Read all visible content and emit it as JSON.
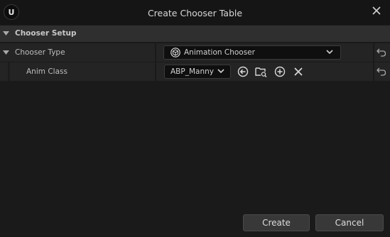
{
  "window": {
    "title": "Create Chooser Table",
    "logo_text": "U"
  },
  "section": {
    "label": "Chooser Setup"
  },
  "rows": [
    {
      "label": "Chooser Type",
      "value": "Animation Chooser"
    },
    {
      "label": "Anim Class",
      "value": "ABP_Manny"
    }
  ],
  "buttons": {
    "create": "Create",
    "cancel": "Cancel"
  },
  "icons": {
    "logo": "unreal-logo-icon",
    "close": "close-icon",
    "reset": "reset-to-default-icon",
    "use_selected": "use-selected-icon",
    "browse": "browse-asset-icon",
    "add": "add-icon",
    "clear": "clear-icon"
  },
  "colors": {
    "background": "#1a1a1a",
    "row": "#242424",
    "section": "#2f2f2f",
    "button": "#383838"
  }
}
